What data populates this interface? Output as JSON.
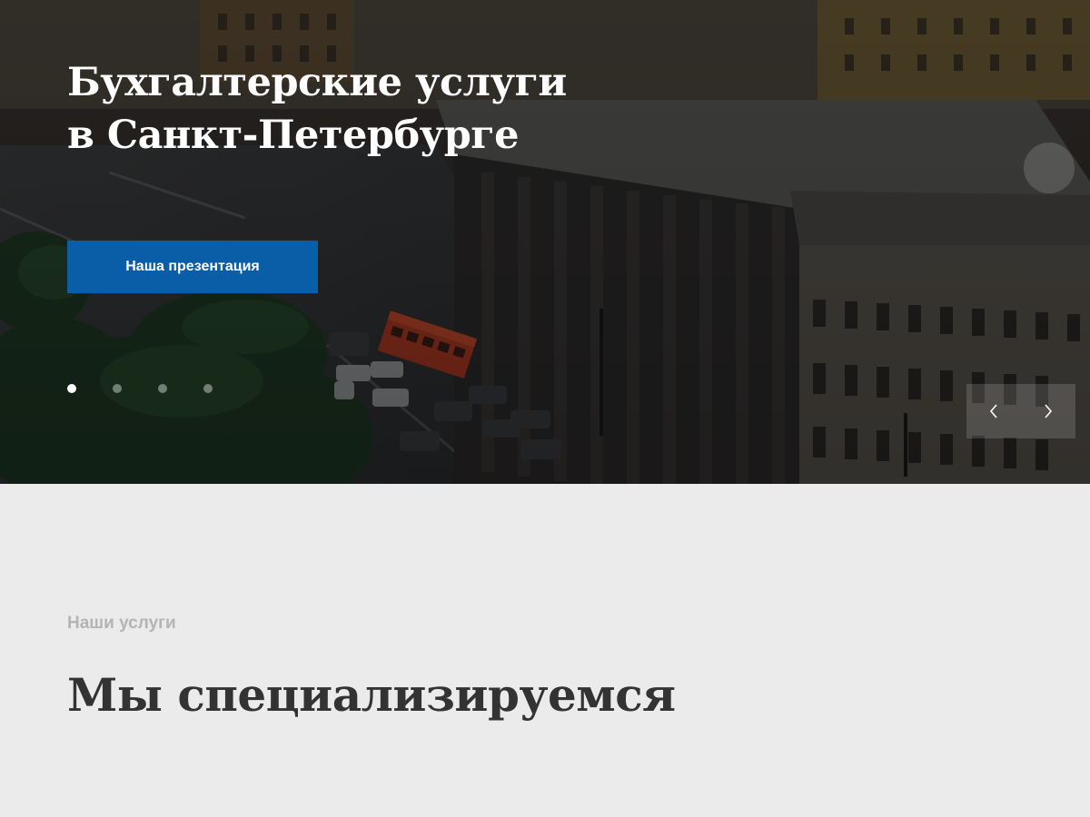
{
  "hero": {
    "title_line1": "Бухгалтерские услуги",
    "title_line2": "в Санкт-Петербурге",
    "button_label": "Наша презентация",
    "dots": [
      "slide-1",
      "slide-2",
      "slide-3",
      "slide-4"
    ],
    "active_dot": 0,
    "prev_icon": "chevron-left-icon",
    "next_icon": "chevron-right-icon"
  },
  "services": {
    "kicker": "Наши услуги",
    "heading": "Мы специализируемся"
  },
  "colors": {
    "accent": "#0a5ea8",
    "section_bg": "#ebebeb",
    "heading_text": "#333333",
    "kicker_text": "#b4b4b4"
  }
}
